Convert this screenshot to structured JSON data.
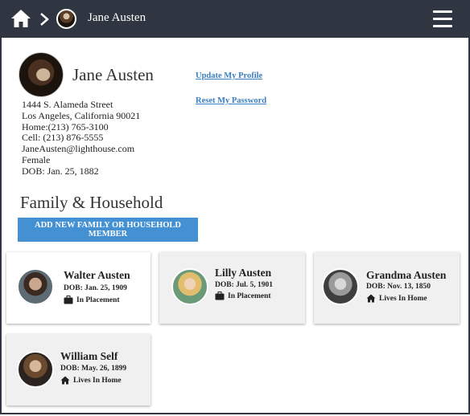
{
  "header": {
    "breadcrumb_name": "Jane Austen",
    "icons": [
      "home-icon",
      "chevron-right-icon",
      "avatar",
      "hamburger-menu-icon"
    ],
    "background": "#2f3541"
  },
  "profile": {
    "name": "Jane Austen",
    "address_line1": "1444 S. Alameda Street",
    "address_line2": "Los Angeles, California 90021",
    "home_phone": "Home:(213) 765-3100",
    "cell_phone": "Cell: (213) 876-5555",
    "email": "JaneAusten@lighthouse.com",
    "gender": "Female",
    "dob": "DOB: Jan. 25, 1882",
    "links": {
      "update_profile": "Update My  Profile",
      "reset_password": "Reset My Password"
    }
  },
  "family": {
    "title": "Family & Household",
    "add_button": "ADD NEW FAMILY OR HOUSEHOLD MEMBER",
    "accent": "#4390d2",
    "members": [
      {
        "name": "Walter Austen",
        "dob": "DOB: Jan. 25, 1909",
        "status": "In Placement",
        "status_icon": "briefcase-icon"
      },
      {
        "name": "Lilly Austen",
        "dob": "DOB: Jul. 5, 1901",
        "status": "In Placement",
        "status_icon": "briefcase-icon"
      },
      {
        "name": "Grandma Austen",
        "dob": "DOB: Nov. 13, 1850",
        "status": "Lives In Home",
        "status_icon": "home-icon"
      },
      {
        "name": "William Self",
        "dob": "DOB: May. 26, 1899",
        "status": "Lives In Home",
        "status_icon": "home-icon"
      }
    ]
  }
}
